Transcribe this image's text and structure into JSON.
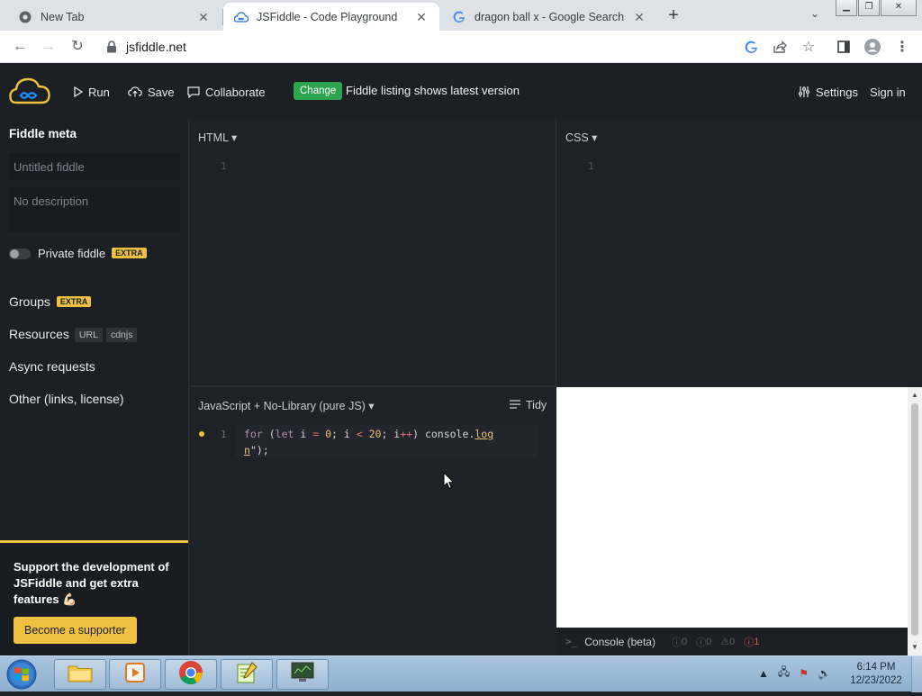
{
  "browser": {
    "tabs": [
      {
        "title": "New Tab",
        "favicon": "chrome-icon",
        "active": false
      },
      {
        "title": "JSFiddle - Code Playground",
        "favicon": "jsfiddle-icon",
        "active": true
      },
      {
        "title": "dragon ball x - Google Search",
        "favicon": "google-icon",
        "active": false
      }
    ],
    "url": "jsfiddle.net"
  },
  "header": {
    "run_label": "Run",
    "save_label": "Save",
    "collaborate_label": "Collaborate",
    "change_badge": "Change",
    "change_message": "Fiddle listing shows latest version",
    "settings_label": "Settings",
    "signin_label": "Sign in"
  },
  "sidebar": {
    "title": "Fiddle meta",
    "title_placeholder": "Untitled fiddle",
    "description_placeholder": "No description",
    "private_label": "Private fiddle",
    "extra_badge": "EXTRA",
    "groups_label": "Groups",
    "resources_label": "Resources",
    "url_tag": "URL",
    "cdnjs_tag": "cdnjs",
    "async_label": "Async requests",
    "other_label": "Other (links, license)",
    "promo_text": "Support the development of JSFiddle and get extra features 💪🏻",
    "promo_button": "Become a supporter"
  },
  "panels": {
    "html_label": "HTML",
    "css_label": "CSS",
    "js_label": "JavaScript + No-Library (pure JS)",
    "tidy_label": "Tidy",
    "line_one": "1"
  },
  "code": {
    "for": "for",
    "open": " (",
    "let": "let",
    "i1": " i ",
    "eq": "=",
    "sp1": " ",
    "zero": "0",
    "semi1": "; i ",
    "lt": "<",
    "sp2": " ",
    "twenty": "20",
    "semi2": "; i",
    "inc": "++",
    "close": ") console.",
    "log1": "log",
    "log2": "n",
    "end": "\");"
  },
  "console": {
    "label": "Console (beta)",
    "counts": [
      "0",
      "0",
      "0"
    ],
    "errors": "1"
  },
  "taskbar": {
    "time": "6:14 PM",
    "date": "12/23/2022"
  },
  "colors": {
    "accent": "#f0c040",
    "change_green": "#2da44e",
    "error_red": "#e05252"
  }
}
